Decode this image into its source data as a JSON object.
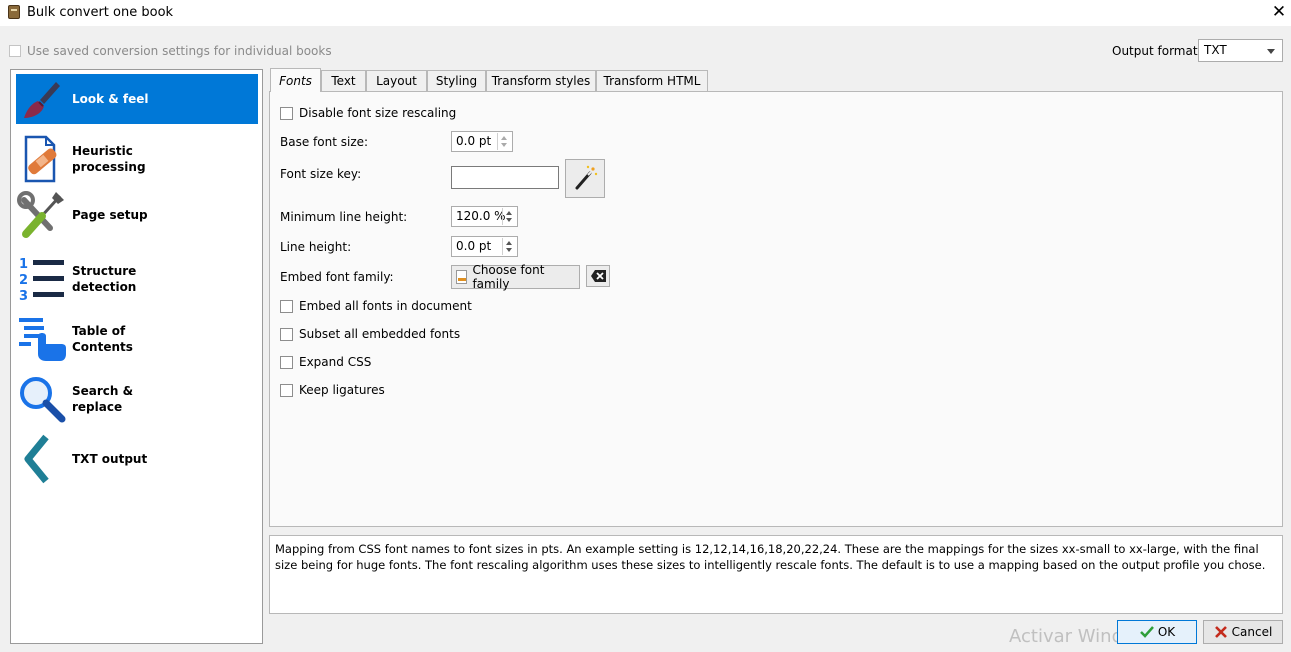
{
  "window": {
    "title": "Bulk convert one book",
    "close_symbol": "✕"
  },
  "top": {
    "saved_settings_label": "Use saved conversion settings for individual books",
    "output_format_label": "Output format:",
    "output_format_value": "TXT"
  },
  "sidebar": {
    "items": [
      {
        "label_lines": [
          "Look & feel"
        ],
        "icon": "paintbrush-icon",
        "selected": true
      },
      {
        "label_lines": [
          "Heuristic",
          "processing"
        ],
        "icon": "document-bandage-icon"
      },
      {
        "label_lines": [
          "Page setup"
        ],
        "icon": "wrench-screwdriver-icon"
      },
      {
        "label_lines": [
          "Structure",
          "detection"
        ],
        "icon": "numbered-list-icon"
      },
      {
        "label_lines": [
          "Table of",
          "Contents"
        ],
        "icon": "toc-pointer-icon"
      },
      {
        "label_lines": [
          "Search &",
          "replace"
        ],
        "icon": "magnifier-icon"
      },
      {
        "label_lines": [
          "TXT output"
        ],
        "icon": "chevron-left-icon"
      }
    ]
  },
  "tabs": [
    {
      "label": "Fonts",
      "active": true
    },
    {
      "label": "Text"
    },
    {
      "label": "Layout"
    },
    {
      "label": "Styling"
    },
    {
      "label": "Transform styles"
    },
    {
      "label": "Transform HTML"
    }
  ],
  "fonts": {
    "disable_rescaling_label": "Disable font size rescaling",
    "base_font_size_label": "Base font size:",
    "base_font_size_value": "0.0 pt",
    "font_size_key_label": "Font size key:",
    "font_size_key_value": "",
    "min_line_height_label": "Minimum line height:",
    "min_line_height_value": "120.0 %",
    "line_height_label": "Line height:",
    "line_height_value": "0.0 pt",
    "embed_font_family_label": "Embed font family:",
    "choose_font_family_label": "Choose font family",
    "embed_all_fonts_label": "Embed all fonts in document",
    "subset_fonts_label": "Subset all embedded fonts",
    "expand_css_label": "Expand CSS",
    "keep_ligatures_label": "Keep ligatures"
  },
  "help_text": "Mapping from CSS font names to font sizes in pts. An example setting is 12,12,14,16,18,20,22,24. These are the mappings for the sizes xx-small to xx-large, with the final size being for huge fonts. The font rescaling algorithm uses these sizes to intelligently rescale fonts. The default is to use a mapping based on the output profile you chose.",
  "watermark": "Activar Windows",
  "buttons": {
    "ok": "OK",
    "cancel": "Cancel"
  },
  "colors": {
    "selection": "#0078d7",
    "ok_check": "#2e9e3a",
    "cancel_x": "#c42b1c"
  }
}
